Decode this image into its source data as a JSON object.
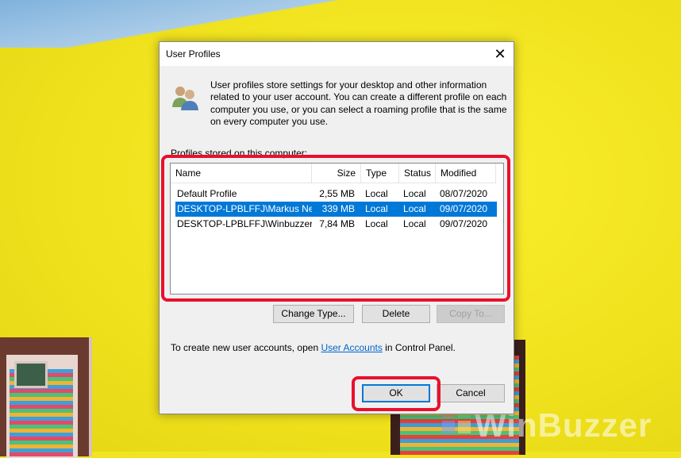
{
  "dialog": {
    "title": "User Profiles",
    "description": "User profiles store settings for your desktop and other information related to your user account. You can create a different profile on each computer you use, or you can select a roaming profile that is the same on every computer you use.",
    "profiles_label": "Profiles stored on this computer:",
    "columns": [
      "Name",
      "Size",
      "Type",
      "Status",
      "Modified"
    ],
    "rows": [
      {
        "name": "Default Profile",
        "size": "2,55 MB",
        "type": "Local",
        "status": "Local",
        "modified": "08/07/2020",
        "selected": false
      },
      {
        "name": "DESKTOP-LPBLFFJ\\Markus Ne...",
        "size": "339 MB",
        "type": "Local",
        "status": "Local",
        "modified": "09/07/2020",
        "selected": true
      },
      {
        "name": "DESKTOP-LPBLFFJ\\Winbuzzer",
        "size": "7,84 MB",
        "type": "Local",
        "status": "Local",
        "modified": "09/07/2020",
        "selected": false
      }
    ],
    "buttons": {
      "change_type": "Change Type...",
      "delete": "Delete",
      "copy_to": "Copy To...",
      "ok": "OK",
      "cancel": "Cancel"
    },
    "footer": {
      "before": "To create new user accounts, open ",
      "link": "User Accounts",
      "after": " in Control Panel."
    }
  },
  "watermark": "WinBuzzer",
  "colors": {
    "highlight": "#e8112d",
    "selection": "#0078d7",
    "background": "#f1e521"
  }
}
